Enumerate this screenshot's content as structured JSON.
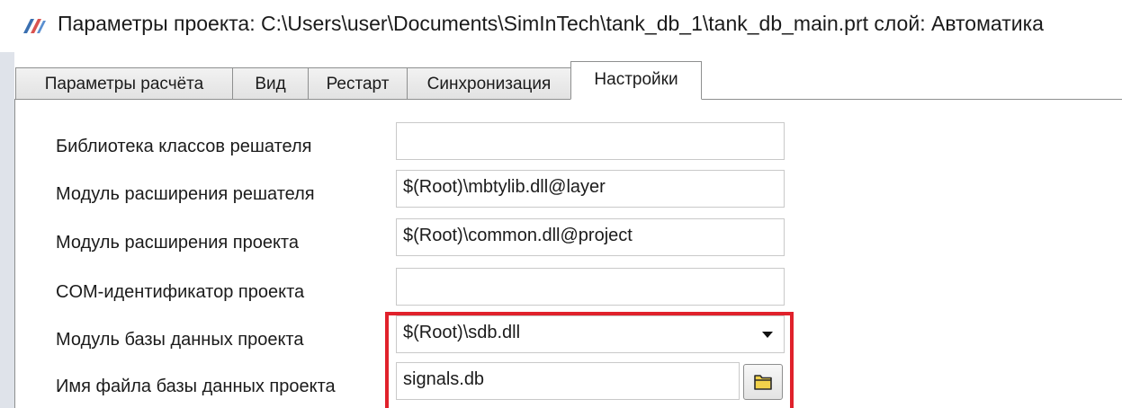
{
  "window": {
    "title": "Параметры проекта: C:\\Users\\user\\Documents\\SimInTech\\tank_db_1\\tank_db_main.prt  слой: Автоматика",
    "icon": "siminttech-app-icon"
  },
  "tabs": [
    {
      "label": "Параметры расчёта",
      "active": false
    },
    {
      "label": "Вид",
      "active": false
    },
    {
      "label": "Рестарт",
      "active": false
    },
    {
      "label": "Синхронизация",
      "active": false
    },
    {
      "label": "Настройки",
      "active": true
    }
  ],
  "settings": {
    "solver_class_library": {
      "label": "Библиотека классов решателя",
      "value": ""
    },
    "solver_extension_module": {
      "label": "Модуль расширения решателя",
      "value": "$(Root)\\mbtylib.dll@layer"
    },
    "project_extension_module": {
      "label": "Модуль расширения проекта",
      "value": "$(Root)\\common.dll@project"
    },
    "project_com_id": {
      "label": "COM-идентификатор проекта",
      "value": ""
    },
    "project_db_module": {
      "label": "Модуль базы данных проекта",
      "value": "$(Root)\\sdb.dll"
    },
    "project_db_file": {
      "label": "Имя файла базы данных проекта",
      "value": "signals.db"
    }
  },
  "colors": {
    "highlight": "#e0212b",
    "folder_icon": "#f2d24b"
  }
}
